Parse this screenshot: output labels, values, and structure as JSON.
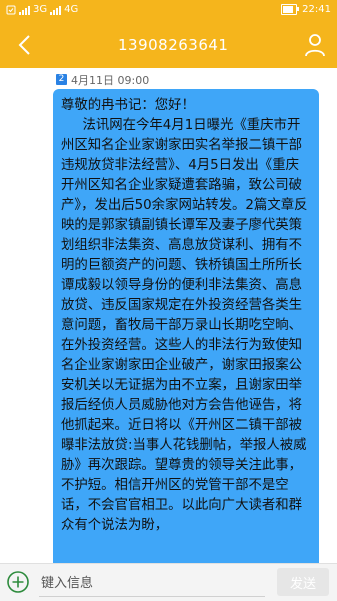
{
  "status_bar": {
    "left_icons": [
      "notification-icon",
      "signal-icon",
      "signal-icon"
    ],
    "network_1": "3G",
    "network_2": "4G",
    "time": "22:41",
    "battery_level": 0.85
  },
  "header": {
    "title": "13908263641",
    "bg_color": "#f5b51c"
  },
  "message": {
    "sim_badge": "2",
    "timestamp": "4月11日 09:00",
    "bubble_color": "#3fa6f8",
    "greeting": "尊敬的冉书记：您好！",
    "body": "法讯网在今年4月1日曝光《重庆市开州区知名企业家谢家田实名举报二镇干部违规放贷非法经营》、4月5日发出《重庆开州区知名企业家疑遭套路骗，致公司破产》，发出后50余家网站转发。2篇文章反映的是郭家镇副镇长谭军及妻子廖代英策划组织非法集资、高息放贷谋利、拥有不明的巨额资产的问题、铁桥镇国土所所长谭成毅以领导身份的便利非法集资、高息放贷、违反国家规定在外投资经营各类生意问题，畜牧局干部万录山长期吃空晌、在外投资经营。这些人的非法行为致使知名企业家谢家田企业破产，谢家田报案公安机关以无证据为由不立案，且谢家田举报后经侦人员威胁他对方会告他诬告，将他抓起来。近日将以《开州区二镇干部被曝非法放贷:当事人花钱删帖，举报人被威胁》再次跟踪。望尊贵的领导关注此事，不护短。相信开州区的党管干部不是空话，不会官官相卫。以此向广大读者和群众有个说法为盼，"
  },
  "composer": {
    "placeholder": "键入信息",
    "value": "",
    "send_label": "发送"
  }
}
